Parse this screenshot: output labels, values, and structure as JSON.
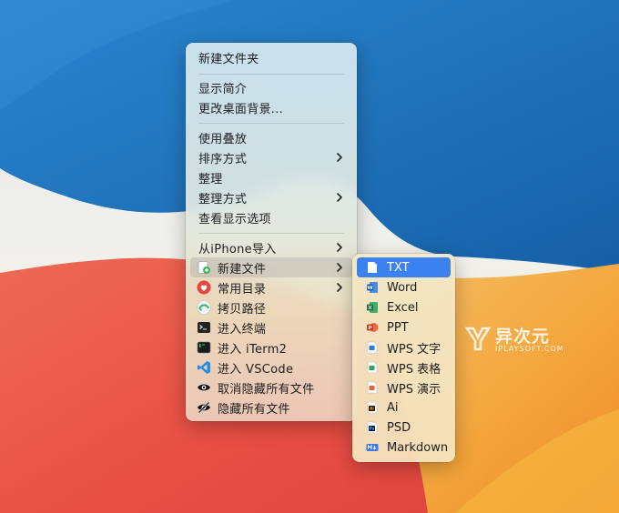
{
  "main_menu": {
    "items": [
      {
        "label": "新建文件夹"
      },
      {
        "label": "显示简介"
      },
      {
        "label": "更改桌面背景..."
      },
      {
        "label": "使用叠放"
      },
      {
        "label": "排序方式"
      },
      {
        "label": "整理"
      },
      {
        "label": "整理方式"
      },
      {
        "label": "查看显示选项"
      },
      {
        "label": "从iPhone导入"
      },
      {
        "label": "新建文件"
      },
      {
        "label": "常用目录"
      },
      {
        "label": "拷贝路径"
      },
      {
        "label": "进入终端"
      },
      {
        "label": "进入 iTerm2"
      },
      {
        "label": "进入 VSCode"
      },
      {
        "label": "取消隐藏所有文件"
      },
      {
        "label": "隐藏所有文件"
      }
    ]
  },
  "submenu": {
    "items": [
      {
        "label": "TXT"
      },
      {
        "label": "Word"
      },
      {
        "label": "Excel"
      },
      {
        "label": "PPT"
      },
      {
        "label": "WPS 文字"
      },
      {
        "label": "WPS 表格"
      },
      {
        "label": "WPS 演示"
      },
      {
        "label": "Ai"
      },
      {
        "label": "PSD"
      },
      {
        "label": "Markdown"
      }
    ]
  },
  "watermark": {
    "title": "异次元",
    "subtitle": "IPLAYSOFT.COM"
  },
  "colors": {
    "selection": "#3b82f0",
    "hover": "#9a9a9a",
    "wallpaper_blue": "#1e6fb8",
    "wallpaper_red": "#e8524a",
    "wallpaper_orange": "#f2a33a"
  }
}
